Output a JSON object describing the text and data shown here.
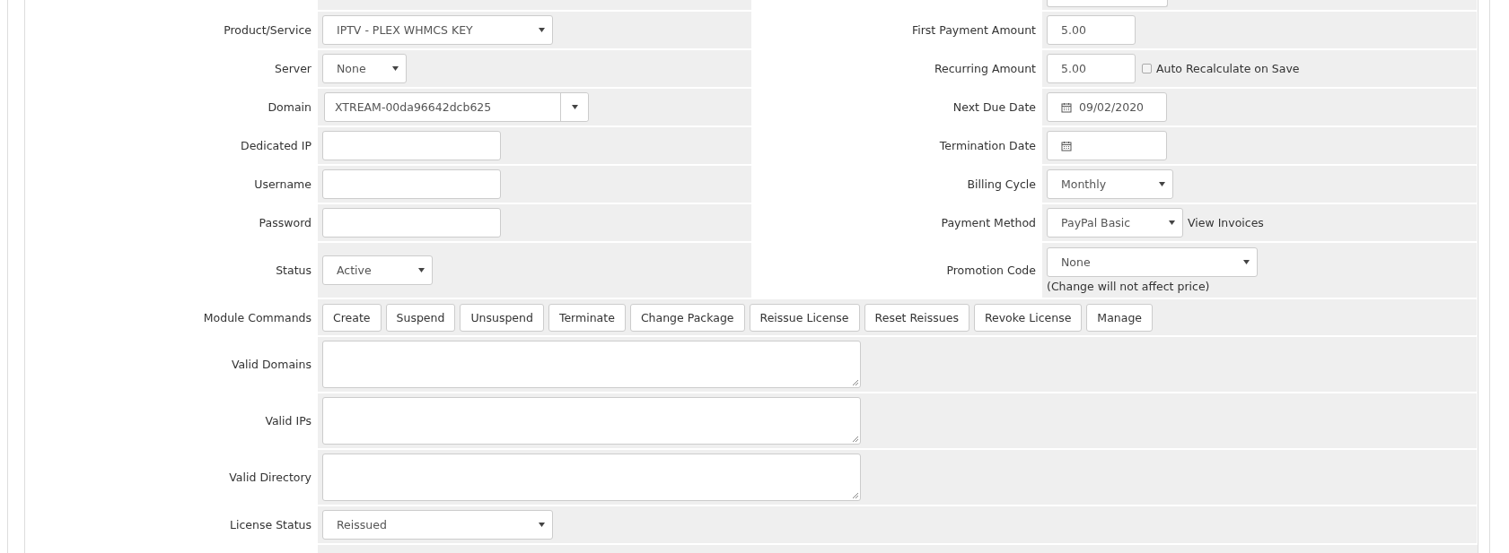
{
  "cut_off_row": {
    "kind": "input"
  },
  "left_rows": [
    {
      "label": "Product/Service",
      "kind": "select",
      "value": "IPTV - PLEX WHMCS KEY"
    },
    {
      "label": "Server",
      "kind": "select",
      "value": "None"
    },
    {
      "label": "Domain",
      "kind": "combo",
      "value": "XTREAM-00da96642dcb625"
    },
    {
      "label": "Dedicated IP",
      "kind": "input"
    },
    {
      "label": "Username",
      "kind": "input"
    },
    {
      "label": "Password",
      "kind": "input"
    },
    {
      "label": "Status",
      "kind": "select",
      "value": "Active"
    }
  ],
  "right_rows": [
    {
      "label": "First Payment Amount",
      "kind": "input",
      "value": "5.00"
    },
    {
      "label": "Recurring Amount",
      "kind": "input",
      "value": "5.00",
      "checkbox": {
        "label": "Auto Recalculate on Save",
        "checked": false
      }
    },
    {
      "label": "Next Due Date",
      "kind": "date",
      "value": "09/02/2020"
    },
    {
      "label": "Termination Date",
      "kind": "date"
    },
    {
      "label": "Billing Cycle",
      "kind": "select",
      "value": "Monthly"
    },
    {
      "label": "Payment Method",
      "kind": "select",
      "value": "PayPal Basic",
      "link": "View Invoices"
    },
    {
      "label": "Promotion Code",
      "kind": "select",
      "value": "None",
      "note": "(Change will not affect price)"
    }
  ],
  "full_rows": [
    {
      "label": "Module Commands",
      "kind": "buttons",
      "buttons": [
        "Create",
        "Suspend",
        "Unsuspend",
        "Terminate",
        "Change Package",
        "Reissue License",
        "Reset Reissues",
        "Revoke License",
        "Manage"
      ]
    },
    {
      "label": "Valid Domains",
      "kind": "textarea"
    },
    {
      "label": "Valid IPs",
      "kind": "textarea"
    },
    {
      "label": "Valid Directory",
      "kind": "textarea"
    },
    {
      "label": "License Status",
      "kind": "select",
      "value": "Reissued"
    }
  ]
}
